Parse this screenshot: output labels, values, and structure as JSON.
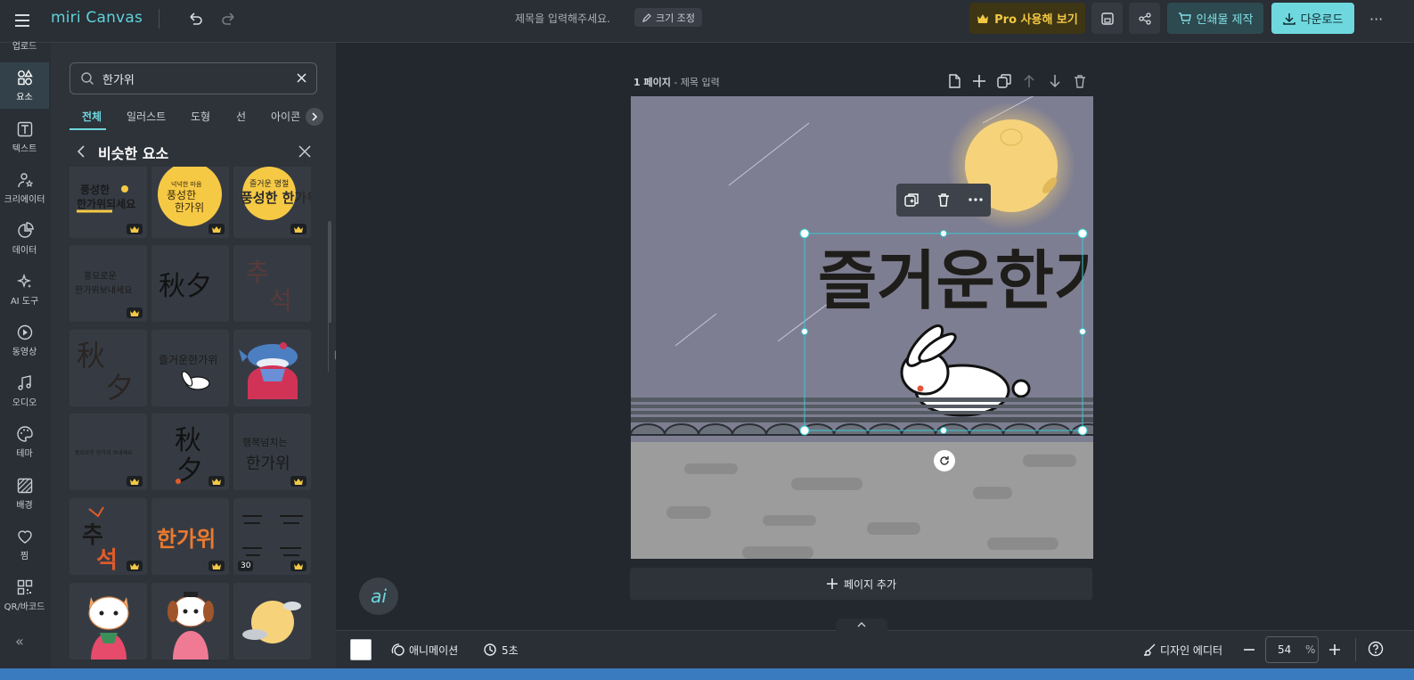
{
  "header": {
    "logo": "miri Canvas",
    "doc_title_placeholder": "제목을 입력해주세요.",
    "resize_label": "크기 조정",
    "pro_label": "Pro 사용해 보기",
    "print_label": "인쇄물 제작",
    "download_label": "다운로드",
    "more_label": "···"
  },
  "nav": {
    "items": [
      {
        "label": "업로드"
      },
      {
        "label": "요소"
      },
      {
        "label": "텍스트"
      },
      {
        "label": "크리에이터"
      },
      {
        "label": "데이터"
      },
      {
        "label": "AI 도구"
      },
      {
        "label": "동영상"
      },
      {
        "label": "오디오"
      },
      {
        "label": "테마"
      },
      {
        "label": "배경"
      },
      {
        "label": "찜"
      },
      {
        "label": "QR/바코드"
      }
    ],
    "active": "요소",
    "collapse_label": "«"
  },
  "panel": {
    "search_value": "한가위",
    "tabs": [
      "전체",
      "일러스트",
      "도형",
      "선",
      "아이콘"
    ],
    "active_tab": "전체",
    "section_title": "비슷한 요소",
    "tiles": [
      {
        "text": "풍성한 한가위되세요",
        "pro": true
      },
      {
        "text": "넉넉한 마음 풍성한 한가위",
        "pro": true
      },
      {
        "text": "즐거운 명절 풍성한 한가위",
        "pro": true
      },
      {
        "text": "풍요로운 한가위보내세요",
        "pro": true
      },
      {
        "text": "秋夕",
        "pro": false
      },
      {
        "text": "추석",
        "pro": false
      },
      {
        "text": "秋夕",
        "pro": false
      },
      {
        "text": "즐거운한가위",
        "pro": false
      },
      {
        "text": "",
        "pro": false
      },
      {
        "text": "풍요로운 한가위 보내세요",
        "pro": true
      },
      {
        "text": "秋夕",
        "pro": true
      },
      {
        "text": "행복넘치는 한가위",
        "pro": true
      },
      {
        "text": "추석",
        "pro": true
      },
      {
        "text": "한가위",
        "pro": true
      },
      {
        "text": "",
        "pro": true,
        "count": "30"
      },
      {
        "text": "",
        "pro": false
      },
      {
        "text": "",
        "pro": false
      },
      {
        "text": "",
        "pro": false
      }
    ]
  },
  "canvas": {
    "page_label": "1 페이지",
    "page_title_placeholder": "- 제목 입력",
    "art_text": "즐거운한가위",
    "add_page_label": "페이지 추가",
    "ai_label": "ai"
  },
  "bottom": {
    "animation_label": "애니메이션",
    "duration_label": "5초",
    "design_editor_label": "디자인 에디터",
    "zoom_value": "54",
    "zoom_unit": "%"
  },
  "colors": {
    "accent": "#6fd8df",
    "pro": "#f3c843",
    "sky": "#7e7e92",
    "moon": "#f6d37a"
  }
}
